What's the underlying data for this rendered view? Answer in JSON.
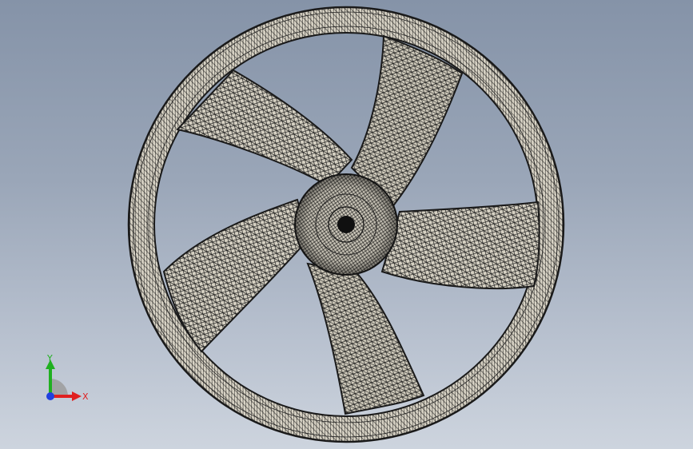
{
  "viewport": {
    "background_top": "#8593a8",
    "background_bottom": "#cdd4de"
  },
  "model": {
    "name": "axial-fan-impeller-mesh",
    "blade_count": 5,
    "mesh_color": "#d9d4c6",
    "edge_color": "#1a1a1a"
  },
  "triad": {
    "x_label": "X",
    "y_label": "Y",
    "x_color": "#e02020",
    "y_color": "#20b020",
    "z_color": "#2040e0"
  }
}
